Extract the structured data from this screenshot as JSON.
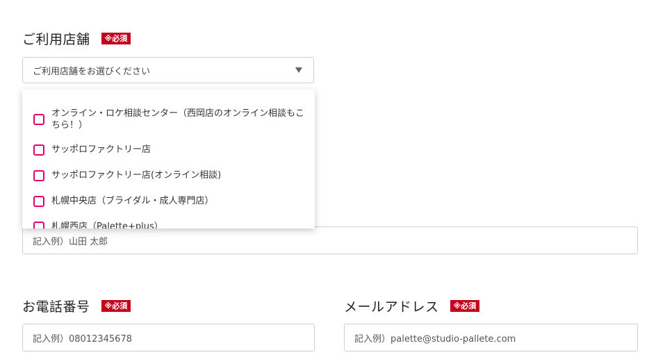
{
  "store": {
    "label": "ご利用店舗",
    "required": "※必須",
    "placeholder": "ご利用店舗をお選びください",
    "options": [
      "オンライン・ロケ相談センター（西岡店のオンライン相談もこちら！）",
      "サッポロファクトリー店",
      "サッポロファクトリー店(オンライン相談)",
      "札幌中央店（ブライダル・成人専門店）",
      "札幌西店（Palette+plus）"
    ]
  },
  "name": {
    "placeholder": "記入例）山田 太郎"
  },
  "phone": {
    "label": "お電話番号",
    "required": "※必須",
    "placeholder": "記入例）08012345678"
  },
  "email": {
    "label": "メールアドレス",
    "required": "※必須",
    "placeholder": "記入例）palette@studio-pallete.com"
  },
  "colors": {
    "required_badge": "#c4001d",
    "checkbox_border": "#e0006e"
  }
}
